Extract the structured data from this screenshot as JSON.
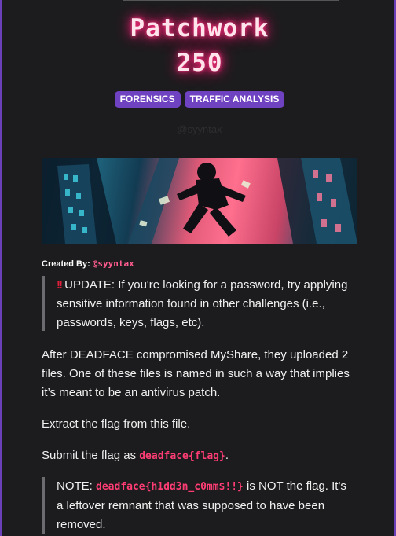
{
  "challenge": {
    "name": "Patchwork",
    "points": "250",
    "tags": [
      "FORENSICS",
      "TRAFFIC ANALYSIS"
    ],
    "author_ghost": "@syyntax"
  },
  "created_by": {
    "label": "Created By:",
    "handle": "@syyntax"
  },
  "update_note": {
    "icon": "!!",
    "text": "UPDATE: If you're looking for a password, try applying sensitive information found in other challenges (i.e., passwords, keys, flags, etc)."
  },
  "description": {
    "p1": "After DEADFACE compromised MyShare, they uploaded 2 files. One of these files is named in such a way that implies it’s meant to be an antivirus patch.",
    "p2": "Extract the flag from this file.",
    "p3_prefix": "Submit the flag as ",
    "p3_code": "deadface{flag}",
    "p3_suffix": "."
  },
  "note": {
    "prefix": "NOTE: ",
    "code": "deadface{h1dd3n_c0mm$!!}",
    "suffix": " is NOT the flag. It's a leftover remnant that was supposed to have been removed."
  },
  "colors": {
    "accent": "#6f42c1",
    "neon_pink": "#ff2e7e",
    "code_pink": "#ff3d74",
    "background": "#1c1c1e"
  }
}
